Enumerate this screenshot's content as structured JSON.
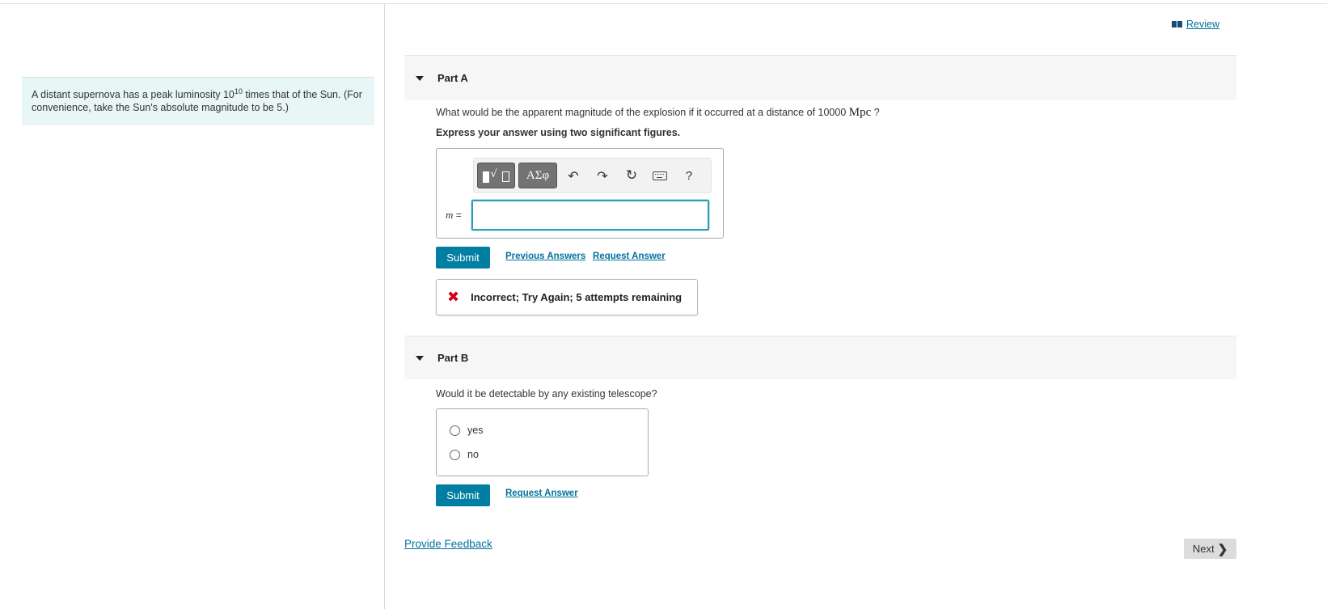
{
  "intro": {
    "text_before": "A distant supernova has a peak luminosity 10",
    "exponent": "10",
    "text_after": " times that of the Sun. (For convenience, take the Sun's absolute magnitude to be 5.)"
  },
  "header": {
    "review_label": " Review",
    "review_icon": "book-icon"
  },
  "part_a": {
    "title": "Part A",
    "question_before": "What would be the apparent magnitude of the explosion if it occurred at a distance of 10000 ",
    "question_unit": "Mpc",
    "question_after": " ?",
    "instruction": "Express your answer using two significant figures.",
    "toolbar": {
      "greek": "ΑΣφ",
      "undo": "↶",
      "redo": "↷",
      "reset": "↻",
      "help": "?"
    },
    "variable": "m",
    "equals": " =",
    "answer_value": "",
    "submit_label": "Submit",
    "previous_answers_label": "Previous Answers",
    "request_answer_label": "Request Answer",
    "feedback": {
      "icon": "✖",
      "message": "Incorrect; Try Again; 5 attempts remaining",
      "color": "#d0021b"
    }
  },
  "part_b": {
    "title": "Part B",
    "question": "Would it be detectable by any existing telescope?",
    "options": [
      "yes",
      "no"
    ],
    "submit_label": "Submit",
    "request_answer_label": "Request Answer"
  },
  "footer": {
    "feedback_link": "Provide Feedback",
    "next_label": "Next",
    "next_chevron": "❯"
  },
  "colors": {
    "accent": "#007fa3",
    "link": "#00729e",
    "intro_bg": "#e8f6f6"
  }
}
